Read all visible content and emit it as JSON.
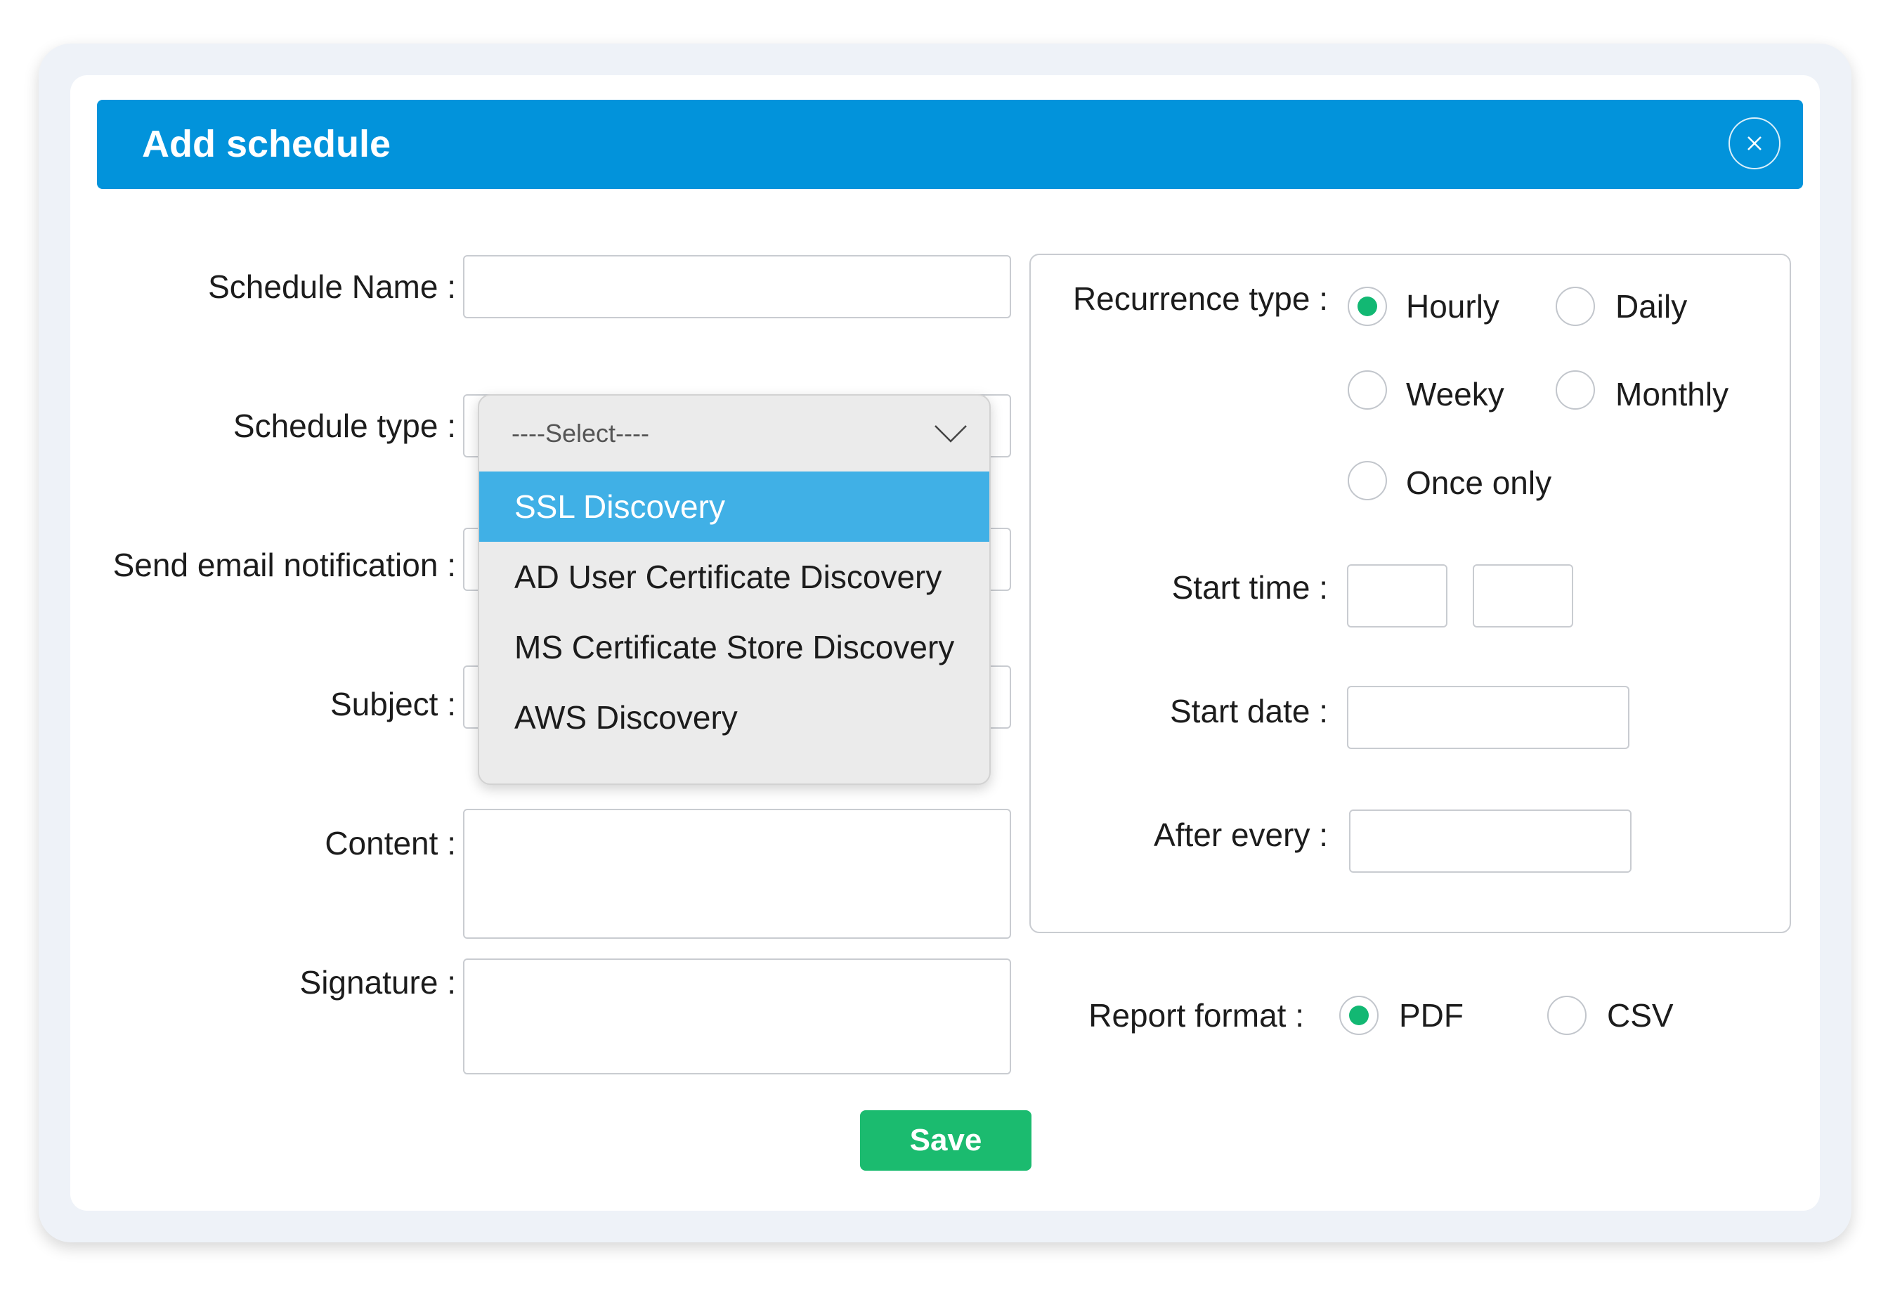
{
  "dialog": {
    "title": "Add schedule",
    "close_icon": "close-icon"
  },
  "form": {
    "schedule_name_label": "Schedule Name :",
    "schedule_type_label": "Schedule type :",
    "send_email_label": "Send email notification :",
    "subject_label": "Subject :",
    "content_label": "Content :",
    "signature_label": "Signature :"
  },
  "dropdown": {
    "placeholder": "----Select----",
    "chevron_icon": "chevron-down-icon",
    "options": [
      "SSL Discovery",
      "AD User Certificate Discovery",
      "MS Certificate Store Discovery",
      "AWS Discovery"
    ],
    "highlighted": "SSL Discovery"
  },
  "recurrence": {
    "label": "Recurrence type :",
    "options": [
      "Hourly",
      "Daily",
      "Weeky",
      "Monthly",
      "Once only"
    ],
    "selected": "Hourly",
    "start_time_label": "Start time :",
    "start_date_label": "Start date :",
    "after_every_label": "After every :"
  },
  "report": {
    "label": "Report format :",
    "options": [
      "PDF",
      "CSV"
    ],
    "selected": "PDF"
  },
  "save_label": "Save",
  "colors": {
    "header": "#0293db",
    "highlight": "#40b0e6",
    "radio_selected": "#12b873",
    "save_button": "#1bbb6f"
  }
}
